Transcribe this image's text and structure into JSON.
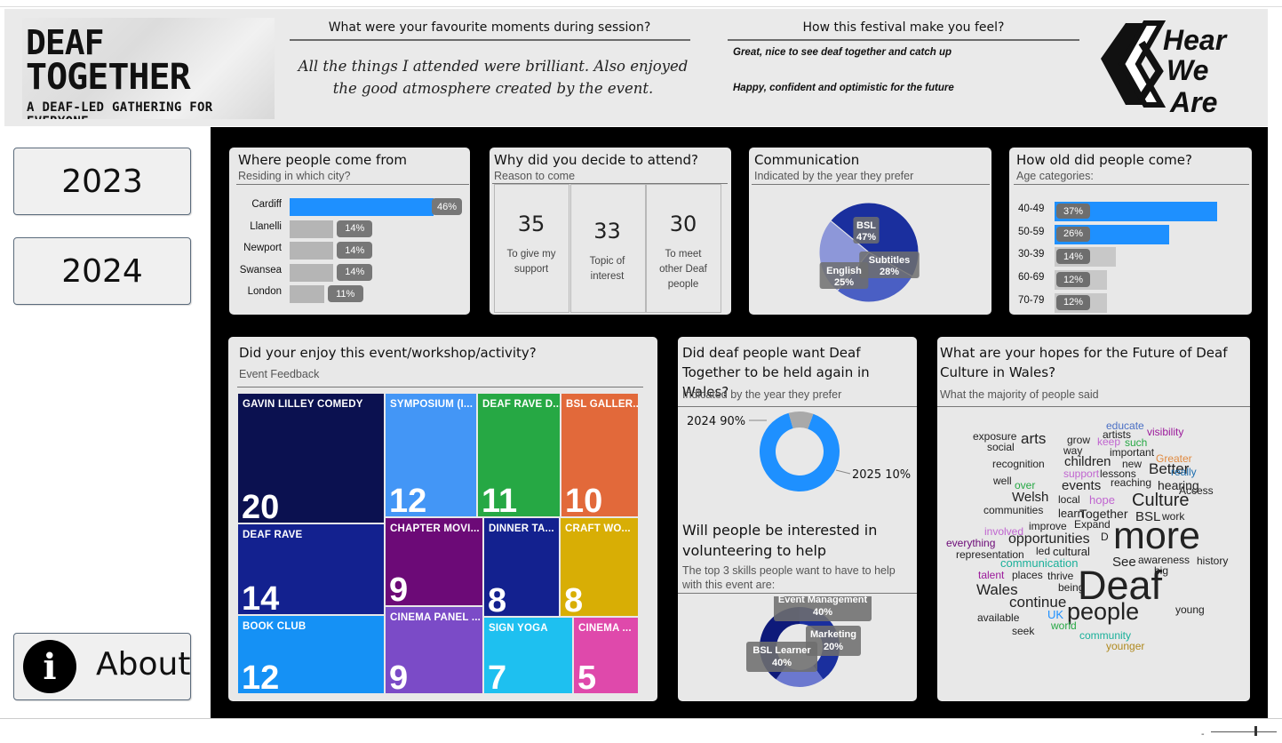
{
  "header": {
    "logo_line1": "DEAF",
    "logo_line2": "TOGETHER",
    "logo_line3": "A DEAF-LED GATHERING FOR EVERYONE",
    "favourite_question": "What were your favourite moments during session?",
    "favourite_answer": "All the things I attended were brilliant. Also enjoyed the good atmosphere created by the event.",
    "feel_question": "How this festival make you feel?",
    "feel_answers": [
      "Great, nice to see deaf together and catch up",
      "Happy, confident and optimistic for the future"
    ],
    "partner_logo_text": [
      "Hear",
      "We",
      "Are"
    ]
  },
  "nav": {
    "year_buttons": [
      "2023",
      "2024"
    ],
    "about_icon": "info-icon",
    "about_label": "About"
  },
  "where_from": {
    "title": "Where people come from",
    "subtitle": "Residing in which city?",
    "items": [
      {
        "city": "Cardiff",
        "pct": 46,
        "label": "46%"
      },
      {
        "city": "Llanelli",
        "pct": 14,
        "label": "14%"
      },
      {
        "city": "Newport",
        "pct": 14,
        "label": "14%"
      },
      {
        "city": "Swansea",
        "pct": 14,
        "label": "14%"
      },
      {
        "city": "London",
        "pct": 11,
        "label": "11%"
      }
    ]
  },
  "why_attend": {
    "title": "Why did you decide to attend?",
    "subtitle": "Reason to come",
    "reasons": [
      {
        "value": "35",
        "label": "To give my support"
      },
      {
        "value": "33",
        "label": "Topic of interest"
      },
      {
        "value": "30",
        "label": "To meet other Deaf people"
      }
    ]
  },
  "communication": {
    "title": "Communication",
    "subtitle": "Indicated by the year they prefer",
    "slices": [
      {
        "name": "BSL",
        "pct": 47,
        "label": "47%",
        "color": "#1a2f9e"
      },
      {
        "name": "Subtitles",
        "pct": 28,
        "label": "28%",
        "color": "#4a5fc4"
      },
      {
        "name": "English",
        "pct": 25,
        "label": "25%",
        "color": "#8d97d9"
      }
    ]
  },
  "age": {
    "title": "How old did people come?",
    "subtitle": "Age categories:",
    "items": [
      {
        "range": "40-49",
        "pct": 37,
        "label": "37%",
        "color": "#1e90ff"
      },
      {
        "range": "50-59",
        "pct": 26,
        "label": "26%",
        "color": "#1e90ff"
      },
      {
        "range": "30-39",
        "pct": 14,
        "label": "14%",
        "color": "#c8c8c8"
      },
      {
        "range": "60-69",
        "pct": 12,
        "label": "12%",
        "color": "#c8c8c8"
      },
      {
        "range": "70-79",
        "pct": 12,
        "label": "12%",
        "color": "#c8c8c8"
      }
    ]
  },
  "feedback": {
    "title": "Did your enjoy this event/workshop/activity?",
    "subtitle": "Event Feedback",
    "tiles": [
      {
        "label": "GAVIN LILLEY COMEDY",
        "value": "20",
        "color": "#0b1150"
      },
      {
        "label": "DEAF RAVE",
        "value": "14",
        "color": "#13218f"
      },
      {
        "label": "BOOK CLUB",
        "value": "12",
        "color": "#1591f5"
      },
      {
        "label": "SYMPOSIUM (I...",
        "value": "12",
        "color": "#4396f6"
      },
      {
        "label": "DEAF RAVE D...",
        "value": "11",
        "color": "#26a844"
      },
      {
        "label": "BSL GALLER...",
        "value": "10",
        "color": "#e2693a"
      },
      {
        "label": "CHAPTER MOVI...",
        "value": "9",
        "color": "#6c0a77"
      },
      {
        "label": "DINNER TA...",
        "value": "8",
        "color": "#13218f"
      },
      {
        "label": "CRAFT WO...",
        "value": "8",
        "color": "#d8ae05"
      },
      {
        "label": "CINEMA PANEL ...",
        "value": "9",
        "color": "#7b4bc7"
      },
      {
        "label": "SIGN YOGA",
        "value": "7",
        "color": "#1ec0f0"
      },
      {
        "label": "CINEMA ...",
        "value": "5",
        "color": "#df49ab"
      }
    ]
  },
  "again_wales": {
    "title": "Did deaf people want Deaf Together to be held again in Wales?",
    "subtitle": "Indicated by the year they prefer",
    "slices": [
      {
        "name": "2024",
        "pct": 90,
        "label": "2024 90%",
        "color": "#1e90ff"
      },
      {
        "name": "2025",
        "pct": 10,
        "label": "2025 10%",
        "color": "#a9a9a9"
      }
    ]
  },
  "volunteer": {
    "title": "Will people be interested in volunteering to help",
    "subtitle": "The top 3 skills people want to have to help with this event are:",
    "slices": [
      {
        "name": "Event Management",
        "pct": 40,
        "label": "40%",
        "color": "#1a2f9e"
      },
      {
        "name": "Marketing",
        "pct": 20,
        "label": "20%",
        "color": "#6b78cf"
      },
      {
        "name": "BSL Learner",
        "pct": 40,
        "label": "40%",
        "color": "#0e1a7a"
      }
    ]
  },
  "hopes": {
    "title": "What are your hopes for the Future of Deaf Culture in Wales?",
    "subtitle": "What the majority of people said",
    "words": [
      {
        "text": "educate",
        "color": "#4a6fc4"
      },
      {
        "text": "exposure",
        "color": "#222"
      },
      {
        "text": "artists",
        "color": "#222"
      },
      {
        "text": "visibility",
        "color": "#9b1a9b"
      },
      {
        "text": "social",
        "color": "#222"
      },
      {
        "text": "arts",
        "color": "#222"
      },
      {
        "text": "grow",
        "color": "#222"
      },
      {
        "text": "keep",
        "color": "#c065d0"
      },
      {
        "text": "such",
        "color": "#26a844"
      },
      {
        "text": "way",
        "color": "#222"
      },
      {
        "text": "important",
        "color": "#222"
      },
      {
        "text": "Greater",
        "color": "#e08a40"
      },
      {
        "text": "recognition",
        "color": "#222"
      },
      {
        "text": "children",
        "color": "#222"
      },
      {
        "text": "new",
        "color": "#222"
      },
      {
        "text": "Better",
        "color": "#222"
      },
      {
        "text": "support",
        "color": "#c065d0"
      },
      {
        "text": "lessons",
        "color": "#222"
      },
      {
        "text": "really",
        "color": "#1e6fb0"
      },
      {
        "text": "well",
        "color": "#222"
      },
      {
        "text": "over",
        "color": "#26a844"
      },
      {
        "text": "events",
        "color": "#222"
      },
      {
        "text": "reaching",
        "color": "#222"
      },
      {
        "text": "hearing",
        "color": "#222"
      },
      {
        "text": "Access",
        "color": "#222"
      },
      {
        "text": "Welsh",
        "color": "#222"
      },
      {
        "text": "local",
        "color": "#222"
      },
      {
        "text": "hope",
        "color": "#c065d0"
      },
      {
        "text": "Culture",
        "color": "#222"
      },
      {
        "text": "communities",
        "color": "#222"
      },
      {
        "text": "learn",
        "color": "#222"
      },
      {
        "text": "Together",
        "color": "#222"
      },
      {
        "text": "BSL",
        "color": "#222"
      },
      {
        "text": "work",
        "color": "#222"
      },
      {
        "text": "improve",
        "color": "#222"
      },
      {
        "text": "Expand",
        "color": "#222"
      },
      {
        "text": "involved",
        "color": "#c065d0"
      },
      {
        "text": "more",
        "color": "#222"
      },
      {
        "text": "everything",
        "color": "#6c0a77"
      },
      {
        "text": "opportunities",
        "color": "#222"
      },
      {
        "text": "D",
        "color": "#222"
      },
      {
        "text": "representation",
        "color": "#222"
      },
      {
        "text": "led",
        "color": "#222"
      },
      {
        "text": "cultural",
        "color": "#222"
      },
      {
        "text": "communication",
        "color": "#1ab09a"
      },
      {
        "text": "See",
        "color": "#222"
      },
      {
        "text": "awareness",
        "color": "#222"
      },
      {
        "text": "history",
        "color": "#222"
      },
      {
        "text": "talent",
        "color": "#9b1a9b"
      },
      {
        "text": "places",
        "color": "#222"
      },
      {
        "text": "thrive",
        "color": "#222"
      },
      {
        "text": "big",
        "color": "#222"
      },
      {
        "text": "Wales",
        "color": "#222"
      },
      {
        "text": "being",
        "color": "#222"
      },
      {
        "text": "Deaf",
        "color": "#222"
      },
      {
        "text": "continue",
        "color": "#222"
      },
      {
        "text": "available",
        "color": "#222"
      },
      {
        "text": "UK",
        "color": "#1e90ff"
      },
      {
        "text": "people",
        "color": "#222"
      },
      {
        "text": "young",
        "color": "#222"
      },
      {
        "text": "seek",
        "color": "#222"
      },
      {
        "text": "world",
        "color": "#26a844"
      },
      {
        "text": "community",
        "color": "#1ab09a"
      },
      {
        "text": "younger",
        "color": "#b08a20"
      }
    ]
  }
}
